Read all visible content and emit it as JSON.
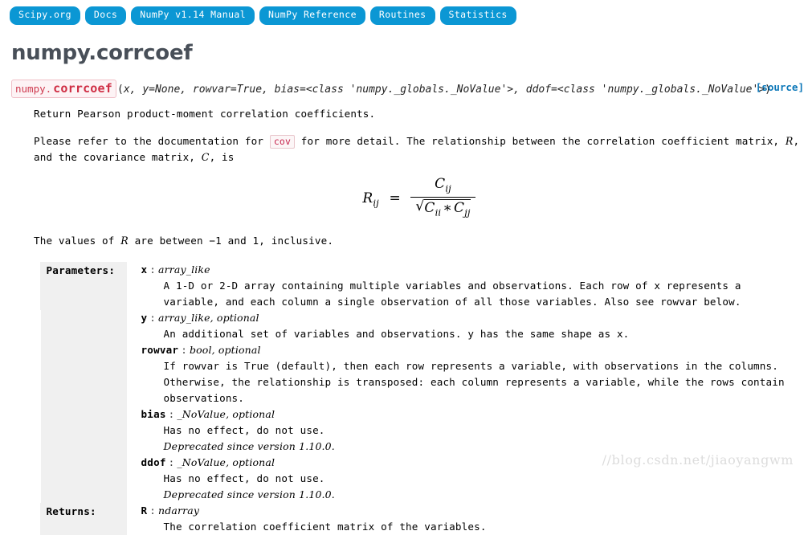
{
  "navbar": {
    "items": [
      {
        "label": "Scipy.org"
      },
      {
        "label": "Docs"
      },
      {
        "label": "NumPy v1.14 Manual"
      },
      {
        "label": "NumPy Reference"
      },
      {
        "label": "Routines"
      },
      {
        "label": "Statistics"
      }
    ]
  },
  "page": {
    "title": "numpy.corrcoef"
  },
  "signature": {
    "prefix": "numpy.",
    "name": "corrcoef",
    "open_paren": "(",
    "args": "x, y=None, rowvar=True, bias=<class 'numpy._globals._NoValue'>, ddof=<class 'numpy._globals._NoValue'>",
    "close_paren": ")",
    "source_label": "[source]"
  },
  "description": {
    "summary": "Return Pearson product-moment correlation coefficients.",
    "refer_part1": "Please refer to the documentation for",
    "refer_code": "cov",
    "refer_part2": "for more detail. The relationship between the correlation coefficient matrix,",
    "refer_var1": "R",
    "refer_part3": ", and the covariance matrix,",
    "refer_var2": "C",
    "refer_part4": ", is",
    "values_part1": "The values of",
    "values_var": "R",
    "values_part2": "are between −1 and 1, inclusive."
  },
  "formula": {
    "lhs": "R",
    "lhs_sub": "ij",
    "equals": "=",
    "numerator": "C",
    "numerator_sub": "ij",
    "den_a": "C",
    "den_a_sub": "ii",
    "den_op": "∗",
    "den_b": "C",
    "den_b_sub": "jj"
  },
  "parameters": {
    "label": "Parameters:",
    "items": [
      {
        "name": "x",
        "sep": ":",
        "type": "array_like",
        "desc": "A 1-D or 2-D array containing multiple variables and observations. Each row of x represents a variable, and each column a single observation of all those variables. Also see rowvar below."
      },
      {
        "name": "y",
        "sep": ":",
        "type": "array_like, optional",
        "desc": "An additional set of variables and observations. y has the same shape as x."
      },
      {
        "name": "rowvar",
        "sep": ":",
        "type": "bool, optional",
        "desc": "If rowvar is True (default), then each row represents a variable, with observations in the columns. Otherwise, the relationship is transposed: each column represents a variable, while the rows contain observations."
      },
      {
        "name": "bias",
        "sep": ":",
        "type": "_NoValue, optional",
        "desc": "Has no effect, do not use.",
        "deprecated": "Deprecated since version 1.10.0."
      },
      {
        "name": "ddof",
        "sep": ":",
        "type": "_NoValue, optional",
        "desc": "Has no effect, do not use.",
        "deprecated": "Deprecated since version 1.10.0."
      }
    ]
  },
  "returns": {
    "label": "Returns:",
    "items": [
      {
        "name": "R",
        "sep": ":",
        "type": "ndarray",
        "desc": "The correlation coefficient matrix of the variables."
      }
    ]
  },
  "watermark": {
    "text": "//blog.csdn.net/jiaoyangwm"
  }
}
